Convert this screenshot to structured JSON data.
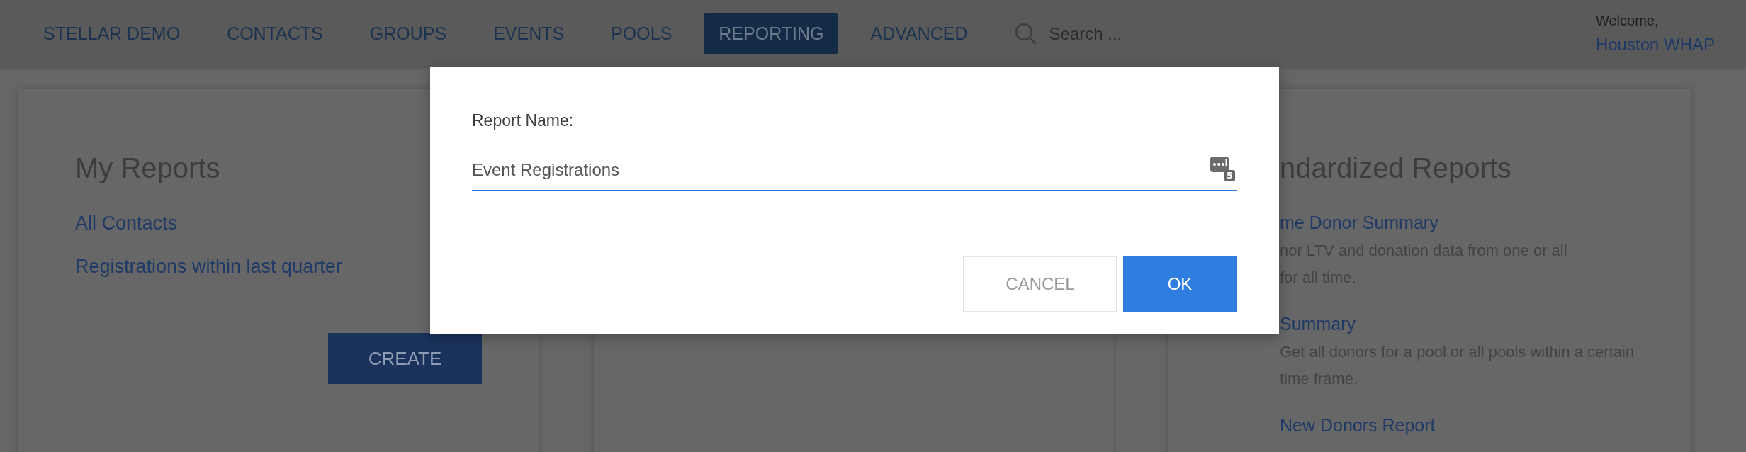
{
  "nav": {
    "brand": "STELLAR DEMO",
    "items": [
      {
        "label": "CONTACTS",
        "selected": false
      },
      {
        "label": "GROUPS",
        "selected": false
      },
      {
        "label": "EVENTS",
        "selected": false
      },
      {
        "label": "POOLS",
        "selected": false
      },
      {
        "label": "REPORTING",
        "selected": true
      },
      {
        "label": "ADVANCED",
        "selected": false
      }
    ],
    "search": {
      "placeholder": "Search ..."
    },
    "user": {
      "greeting": "Welcome,",
      "name": "Houston WHAP"
    }
  },
  "my_reports": {
    "title": "My Reports",
    "links": [
      "All Contacts",
      "Registrations within last quarter"
    ],
    "button": "CREATE"
  },
  "standardized_reports": {
    "title": "ndardized Reports",
    "reports": [
      {
        "name": "me Donor Summary",
        "lines": [
          "nor LTV and donation data from one or all",
          "for all time."
        ]
      },
      {
        "name": "Summary",
        "lines": [
          "Get all donors for a pool or all pools within a certain",
          "time frame."
        ]
      },
      {
        "name": "New Donors Report"
      }
    ]
  },
  "dialog": {
    "label": "Report Name:",
    "value": "Event Registrations",
    "field_badge": "5",
    "buttons": [
      {
        "label": "CANCEL",
        "kind": "secondary"
      },
      {
        "label": "OK",
        "kind": "primary"
      }
    ]
  }
}
